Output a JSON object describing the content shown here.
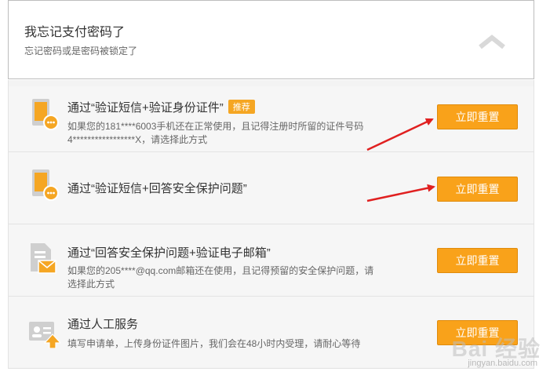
{
  "header": {
    "title": "我忘记支付密码了",
    "subtitle": "忘记密码或是密码被锁定了",
    "collapse_icon": "chevron-up-icon"
  },
  "options": [
    {
      "title": "通过“验证短信+验证身份证件”",
      "badge": "推荐",
      "desc_line1": "如果您的181****6003手机还在正常使用，且记得注册时所留的证件号码",
      "desc_line2": "4*****************X，请选择此方式",
      "button": "立即重置",
      "icon": "phone-sms-icon"
    },
    {
      "title": "通过“验证短信+回答安全保护问题”",
      "button": "立即重置",
      "icon": "phone-sms-icon"
    },
    {
      "title": "通过“回答安全保护问题+验证电子邮箱”",
      "desc_line1": "如果您的205****@qq.com邮箱还在使用，且记得预留的安全保护问题，请",
      "desc_line2": "选择此方式",
      "button": "立即重置",
      "icon": "document-mail-icon"
    },
    {
      "title": "通过人工服务",
      "desc_line1": "填写申请单，上传身份证件图片，我们会在48小时内受理，请耐心等待",
      "button": "立即重置",
      "icon": "id-card-upload-icon"
    }
  ],
  "watermark": {
    "main": "Bai 经验",
    "sub": "jingyan.baidu.com"
  },
  "colors": {
    "button": "#f9a21a",
    "badge": "#f5a623",
    "arrow": "#e02020",
    "icon_orange": "#f5a623",
    "icon_gray": "#cfcfcf"
  }
}
